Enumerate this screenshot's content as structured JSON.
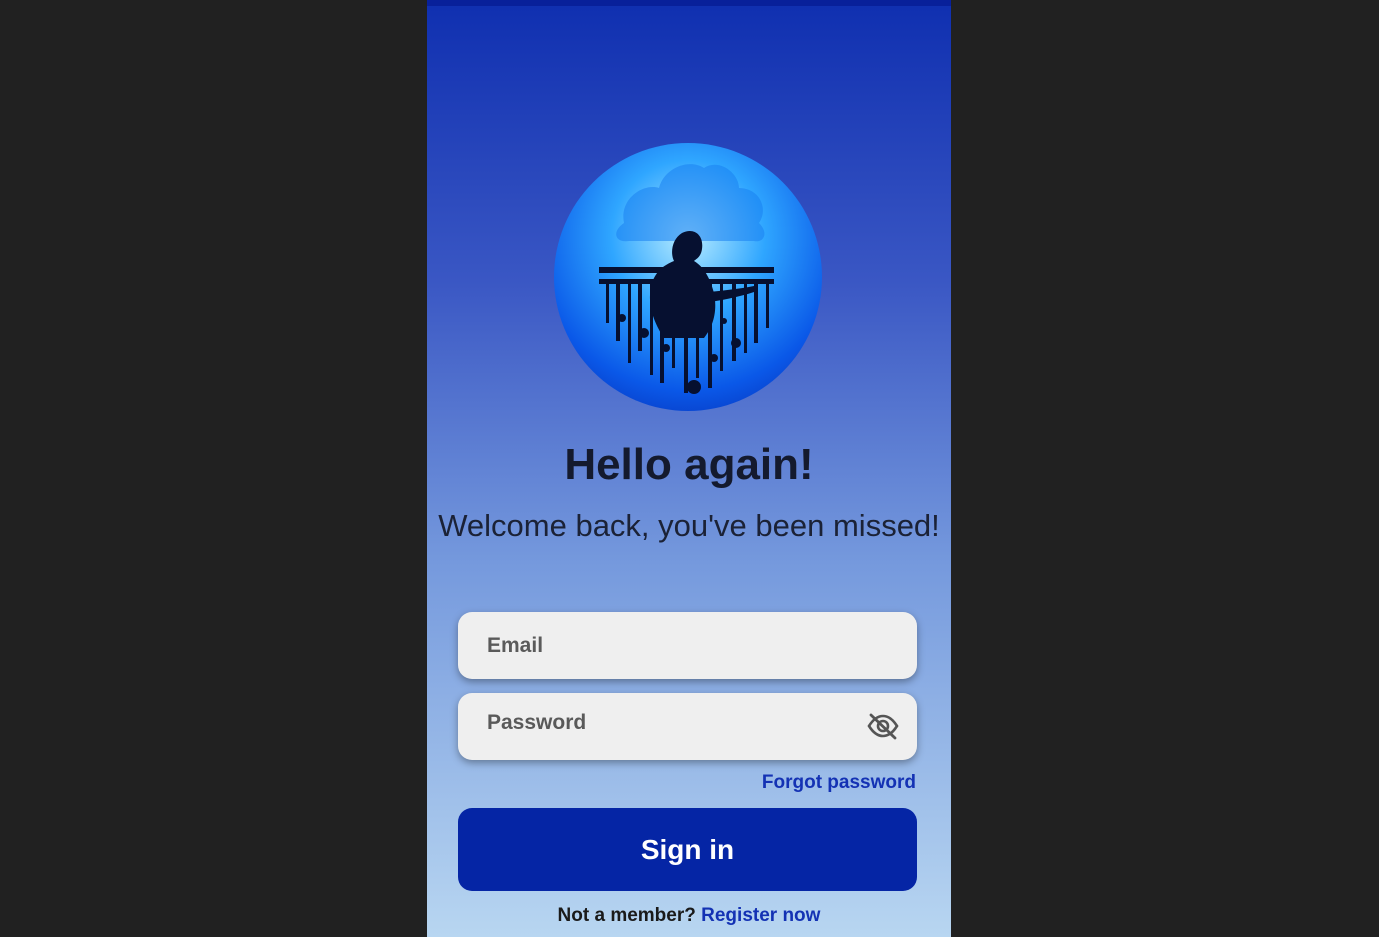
{
  "screen": {
    "background_color": "#212121",
    "accent_color": "#0525a5",
    "link_color": "#1432b4"
  },
  "logo": {
    "icon": "silhouette-piano-logo"
  },
  "header": {
    "title": "Hello again!",
    "subtitle": "Welcome back, you've been missed!"
  },
  "form": {
    "email_placeholder": "Email",
    "password_placeholder": "Password",
    "password_toggle_icon": "eye-off-icon",
    "forgot_password": "Forgot password",
    "sign_in": "Sign in"
  },
  "footer": {
    "prompt": "Not a member?",
    "register": "Register now"
  }
}
